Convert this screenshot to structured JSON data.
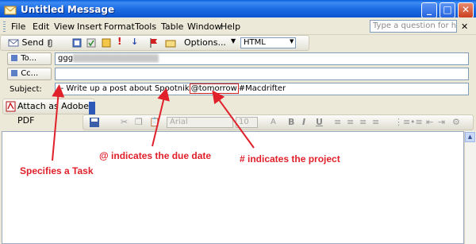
{
  "window": {
    "title": "Untitled Message",
    "buttons": {
      "minimize": "_",
      "maximize": "□",
      "close": "✕"
    }
  },
  "menubar": {
    "items": [
      "File",
      "Edit",
      "View",
      "Insert",
      "Format",
      "Tools",
      "Table",
      "Window",
      "Help"
    ],
    "help_placeholder": "Type a question for help",
    "help_close": "✕"
  },
  "toolbar": {
    "send_label": "Send",
    "options_label": "Options...",
    "format_value": "HTML"
  },
  "header": {
    "to_label": "To...",
    "to_value": "ggg",
    "cc_label": "Cc...",
    "cc_value": "",
    "subject_label": "Subject:",
    "subject_prefix": "-- Write up a post about Spootnik",
    "subject_due": "@tomorrow",
    "subject_project": "#Macdrifter"
  },
  "attach": {
    "label": "Attach as Adobe PDF"
  },
  "format_toolbar": {
    "font": "Arial",
    "size": "10",
    "bold": "B",
    "italic": "I",
    "underline": "U"
  },
  "annotations": {
    "task": "Specifies a Task",
    "due": "@ indicates the due date",
    "project": "# indicates the project"
  },
  "colors": {
    "annotation": "#e0202a",
    "titlebar": "#0b55d0"
  }
}
